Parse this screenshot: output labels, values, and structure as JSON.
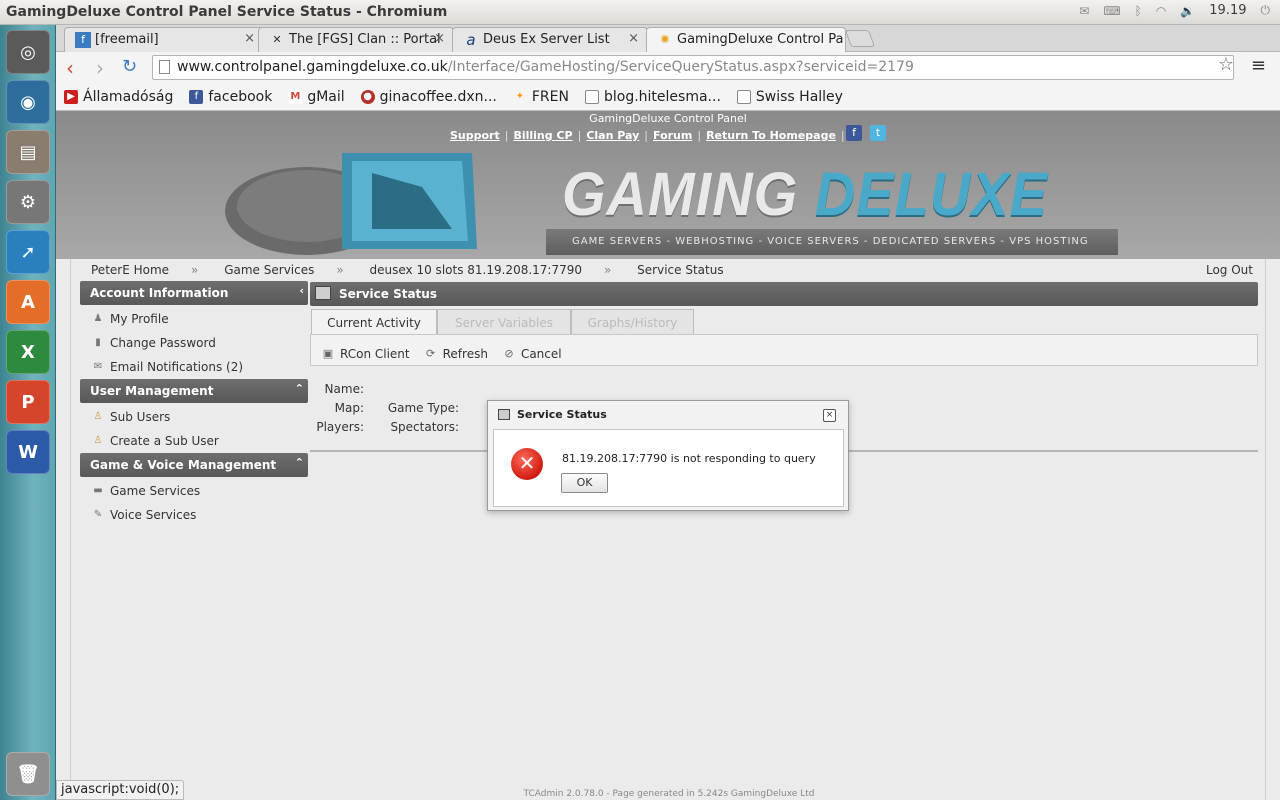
{
  "os": {
    "window_title": "GamingDeluxe Control Panel Service Status - Chromium",
    "clock": "19.19",
    "launcher_icons": [
      "ubuntu-logo-icon",
      "chromium-icon",
      "files-icon",
      "settings-icon",
      "cursor-app-icon",
      "software-center-icon",
      "spreadsheet-icon",
      "presentation-icon",
      "writer-icon",
      "trash-icon"
    ]
  },
  "browser": {
    "tabs": [
      {
        "label": "[freemail]",
        "icon": "freemail-favicon"
      },
      {
        "label": "The [FGS] Clan :: Portal",
        "icon": "fgs-favicon"
      },
      {
        "label": "Deus Ex Server List",
        "icon": "deusex-favicon"
      },
      {
        "label": "GamingDeluxe Control Pa",
        "icon": "gamingdeluxe-favicon"
      }
    ],
    "url_host": "www.controlpanel.gamingdeluxe.co.uk",
    "url_path": "/Interface/GameHosting/ServiceQueryStatus.aspx?serviceid=2179",
    "bookmarks": [
      {
        "label": "Államadóság",
        "icon": "youtube-icon",
        "color": "#cc1e1e"
      },
      {
        "label": "facebook",
        "icon": "facebook-icon",
        "color": "#3b5998"
      },
      {
        "label": "gMail",
        "icon": "gmail-icon",
        "color": "#d44638"
      },
      {
        "label": "ginacoffee.dxn...",
        "icon": "coffee-icon",
        "color": "#b5302a"
      },
      {
        "label": "FREN",
        "icon": "fren-icon",
        "color": "#f39c12"
      },
      {
        "label": "blog.hitelesma...",
        "icon": "page-icon",
        "color": "#ffffff"
      },
      {
        "label": "Swiss Halley",
        "icon": "page-icon",
        "color": "#ffffff"
      }
    ],
    "status_text": "javascript:void(0);"
  },
  "site": {
    "panel_title": "GamingDeluxe Control Panel",
    "links": [
      "Support",
      "Billing CP",
      "Clan Pay",
      "Forum",
      "Return To Homepage"
    ],
    "logo_word1": "GAMING",
    "logo_word2": "DELUXE",
    "tagline": "GAME SERVERS - WEBHOSTING - VOICE SERVERS - DEDICATED SERVERS - VPS HOSTING",
    "brand_color": "#4aa8c8"
  },
  "breadcrumb": {
    "items": [
      "PeterE Home",
      "Game Services",
      "deusex 10 slots 81.19.208.17:7790",
      "Service Status"
    ],
    "separator": "»",
    "logout": "Log Out"
  },
  "sidebar": {
    "sections": [
      {
        "title": "Account Information",
        "items": [
          "My Profile",
          "Change Password",
          "Email Notifications (2)"
        ]
      },
      {
        "title": "User Management",
        "items": [
          "Sub Users",
          "Create a Sub User"
        ]
      },
      {
        "title": "Game & Voice Management",
        "items": [
          "Game Services",
          "Voice Services"
        ]
      }
    ]
  },
  "main": {
    "title": "Service Status",
    "tabs": [
      "Current Activity",
      "Server Variables",
      "Graphs/History"
    ],
    "actions": [
      "RCon Client",
      "Refresh",
      "Cancel"
    ],
    "fields": {
      "name": "Name:",
      "map": "Map:",
      "game_type": "Game Type:",
      "players": "Players:",
      "spectators": "Spectators:"
    },
    "footer": "TCAdmin 2.0.78.0 - Page generated in 5.242s GamingDeluxe Ltd"
  },
  "dialog": {
    "title": "Service Status",
    "message": "81.19.208.17:7790 is not responding to query",
    "ok_label": "OK",
    "close_symbol": "×"
  }
}
